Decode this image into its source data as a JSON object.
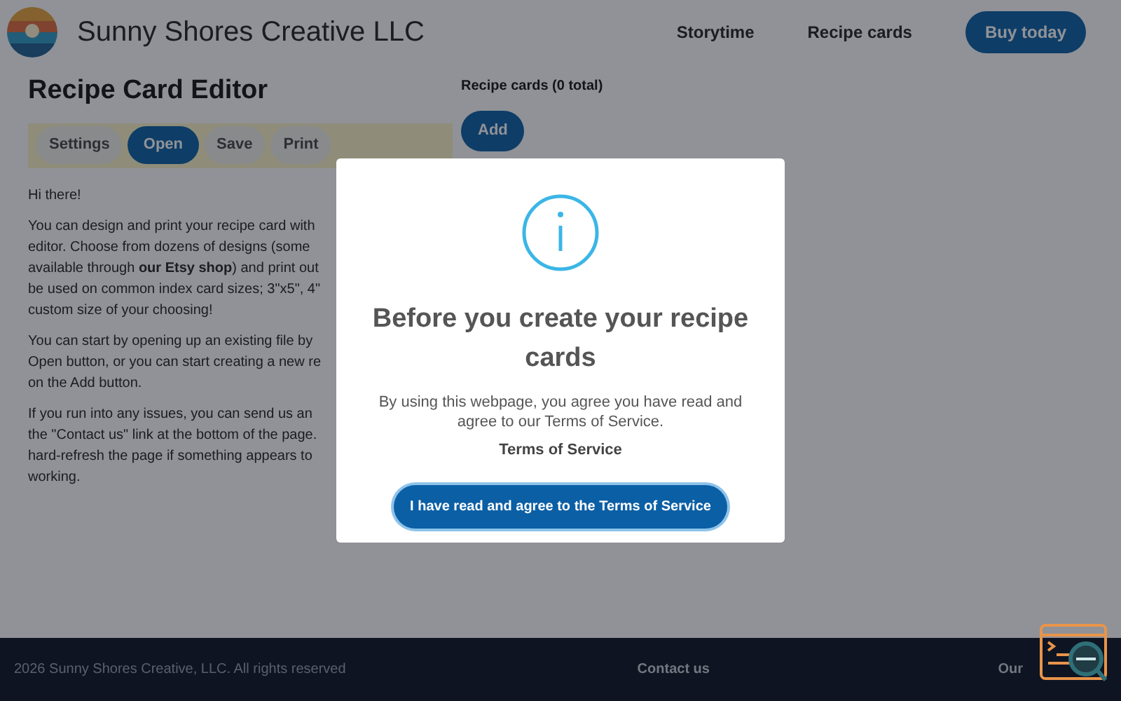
{
  "header": {
    "brand": "Sunny Shores Creative LLC",
    "nav": [
      {
        "label": "Storytime",
        "kind": "link"
      },
      {
        "label": "Recipe cards",
        "kind": "link"
      },
      {
        "label": "Buy today",
        "kind": "button"
      }
    ]
  },
  "editor": {
    "title": "Recipe Card Editor",
    "tabs": [
      {
        "label": "Settings",
        "selected": false
      },
      {
        "label": "Open",
        "selected": true
      },
      {
        "label": "Save",
        "selected": false
      },
      {
        "label": "Print",
        "selected": false
      }
    ],
    "greeting": "Hi there!",
    "paragraphs": [
      [
        "You can design and print your recipe card with",
        "editor. Choose from dozens of designs (some",
        "available through **our Etsy shop**) and print out",
        "be used on common index card sizes; 3\"x5\", 4\"",
        "custom size of your choosing!"
      ],
      [
        "You can start by opening up an existing file by",
        "Open button, or you can start creating a new re",
        "on the Add button."
      ],
      [
        "If you run into any issues, you can send us an",
        "the \"Contact us\" link at the bottom of the page.",
        "hard-refresh the page if something appears to",
        "working."
      ]
    ]
  },
  "recipe_cards": {
    "heading": "Recipe cards (0 total)",
    "add_button": "Add"
  },
  "dialog": {
    "title": "Before you create your recipe cards",
    "message": "By using this webpage, you agree you have read and agree to our Terms of Service.",
    "link": "Terms of Service",
    "button": "I have read and agree to the Terms of Service"
  },
  "footer": {
    "copyright": "2026 Sunny Shores Creative, LLC. All rights reserved",
    "contact": "Contact us",
    "etsy": "Our"
  }
}
